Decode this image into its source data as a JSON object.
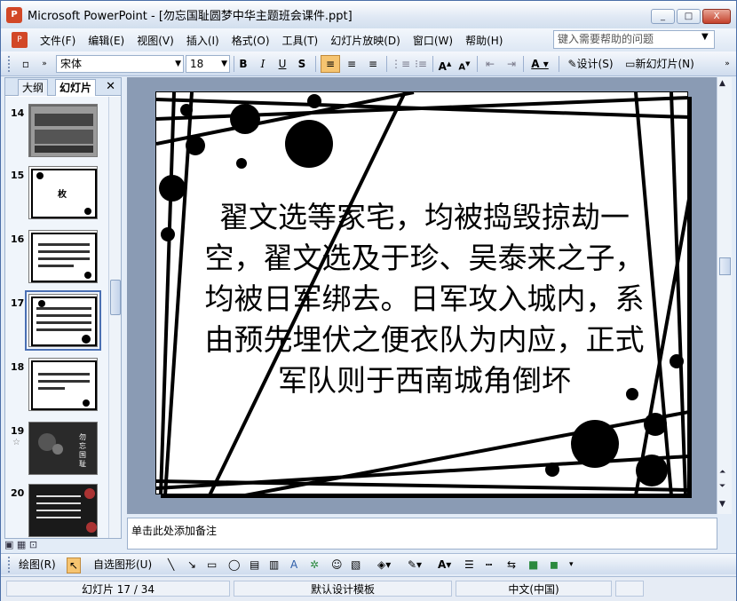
{
  "window": {
    "title": "Microsoft PowerPoint - [勿忘国耻圆梦中华主题班会课件.ppt]",
    "controls": [
      "_",
      "□",
      "X"
    ]
  },
  "menubar": {
    "items": [
      "文件(F)",
      "编辑(E)",
      "视图(V)",
      "插入(I)",
      "格式(O)",
      "工具(T)",
      "幻灯片放映(D)",
      "窗口(W)",
      "帮助(H)"
    ],
    "help_placeholder": "键入需要帮助的问题"
  },
  "toolbar": {
    "font_name": "宋体",
    "font_size": "18",
    "bold": "B",
    "italic": "I",
    "underline": "U",
    "shadow": "S",
    "design_label": "设计(S)",
    "new_slide_label": "新幻灯片(N)"
  },
  "side_panel": {
    "tabs": [
      "大纲",
      "幻灯片"
    ],
    "active_tab": "幻灯片",
    "thumbnails": [
      {
        "num": "14",
        "label": ""
      },
      {
        "num": "15",
        "label": "枚"
      },
      {
        "num": "16",
        "label": ""
      },
      {
        "num": "17",
        "label": ""
      },
      {
        "num": "18",
        "label": ""
      },
      {
        "num": "19",
        "label": "勿忘国耻"
      },
      {
        "num": "20",
        "label": ""
      }
    ],
    "selected": "17"
  },
  "slide": {
    "text": "翟文选等家宅，均被捣毁掠劫一空，翟文选及于珍、吴泰来之子，均被日军绑去。日军攻入城内，系由预先埋伏之便衣队为内应，正式军队则于西南城角倒坏"
  },
  "notes": {
    "placeholder": "单击此处添加备注"
  },
  "drawbar": {
    "draw_label": "绘图(R)",
    "autoshape_label": "自选图形(U)"
  },
  "statusbar": {
    "slide_pos": "幻灯片 17 / 34",
    "template": "默认设计模板",
    "language": "中文(中国)"
  }
}
